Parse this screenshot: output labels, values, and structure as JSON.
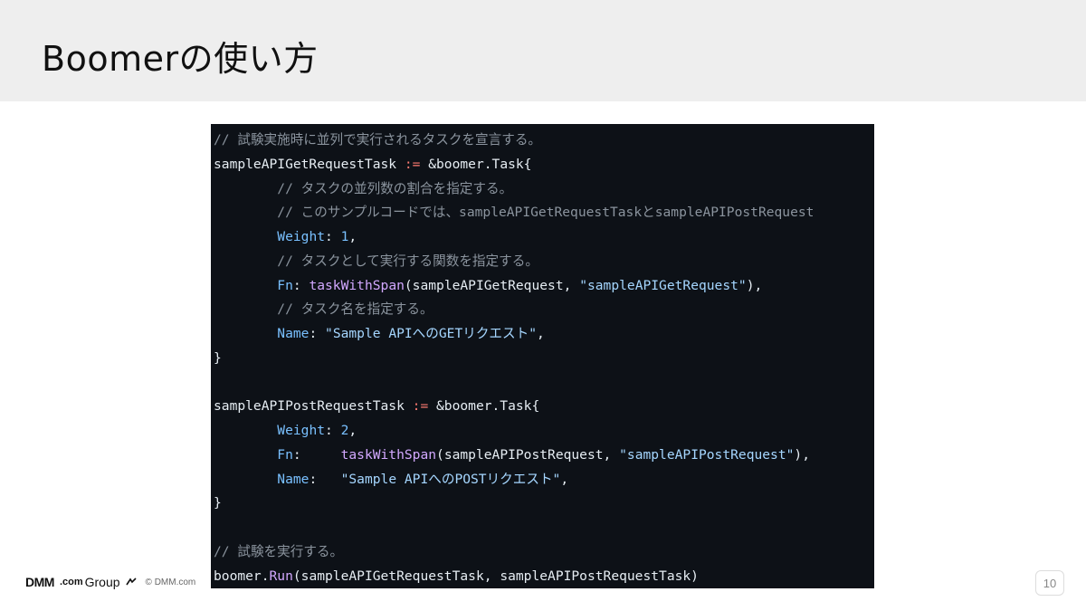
{
  "slide": {
    "title": "Boomerの使い方",
    "page_number": "10"
  },
  "footer": {
    "brand_main": "DMM",
    "brand_dotcom": ".com",
    "brand_group": "Group",
    "copyright": "© DMM.com"
  },
  "code": {
    "lines": [
      [
        [
          "comment",
          "// 試験実施時に並列で実行されるタスクを宣言する。"
        ]
      ],
      [
        [
          "plain",
          "sampleAPIGetRequestTask "
        ],
        [
          "op",
          ":="
        ],
        [
          "plain",
          " &boomer.Task{"
        ]
      ],
      [
        [
          "plain",
          "        "
        ],
        [
          "comment",
          "// タスクの並列数の割合を指定する。"
        ]
      ],
      [
        [
          "plain",
          "        "
        ],
        [
          "comment",
          "// このサンプルコードでは、sampleAPIGetRequestTaskとsampleAPIPostRequest"
        ]
      ],
      [
        [
          "plain",
          "        "
        ],
        [
          "field",
          "Weight"
        ],
        [
          "plain",
          ": "
        ],
        [
          "num",
          "1"
        ],
        [
          "plain",
          ","
        ]
      ],
      [
        [
          "plain",
          "        "
        ],
        [
          "comment",
          "// タスクとして実行する関数を指定する。"
        ]
      ],
      [
        [
          "plain",
          "        "
        ],
        [
          "field",
          "Fn"
        ],
        [
          "plain",
          ": "
        ],
        [
          "func",
          "taskWithSpan"
        ],
        [
          "plain",
          "(sampleAPIGetRequest, "
        ],
        [
          "str",
          "\"sampleAPIGetRequest\""
        ],
        [
          "plain",
          "),"
        ]
      ],
      [
        [
          "plain",
          "        "
        ],
        [
          "comment",
          "// タスク名を指定する。"
        ]
      ],
      [
        [
          "plain",
          "        "
        ],
        [
          "field",
          "Name"
        ],
        [
          "plain",
          ": "
        ],
        [
          "str",
          "\"Sample APIへのGETリクエスト\""
        ],
        [
          "plain",
          ","
        ]
      ],
      [
        [
          "plain",
          "}"
        ]
      ],
      [],
      [
        [
          "plain",
          "sampleAPIPostRequestTask "
        ],
        [
          "op",
          ":="
        ],
        [
          "plain",
          " &boomer.Task{"
        ]
      ],
      [
        [
          "plain",
          "        "
        ],
        [
          "field",
          "Weight"
        ],
        [
          "plain",
          ": "
        ],
        [
          "num",
          "2"
        ],
        [
          "plain",
          ","
        ]
      ],
      [
        [
          "plain",
          "        "
        ],
        [
          "field",
          "Fn"
        ],
        [
          "plain",
          ":     "
        ],
        [
          "func",
          "taskWithSpan"
        ],
        [
          "plain",
          "(sampleAPIPostRequest, "
        ],
        [
          "str",
          "\"sampleAPIPostRequest\""
        ],
        [
          "plain",
          "),"
        ]
      ],
      [
        [
          "plain",
          "        "
        ],
        [
          "field",
          "Name"
        ],
        [
          "plain",
          ":   "
        ],
        [
          "str",
          "\"Sample APIへのPOSTリクエスト\""
        ],
        [
          "plain",
          ","
        ]
      ],
      [
        [
          "plain",
          "}"
        ]
      ],
      [],
      [
        [
          "comment",
          "// 試験を実行する。"
        ]
      ],
      [
        [
          "plain",
          "boomer."
        ],
        [
          "func",
          "Run"
        ],
        [
          "plain",
          "(sampleAPIGetRequestTask, sampleAPIPostRequestTask)"
        ]
      ]
    ]
  },
  "colors": {
    "code_background": "#0d1117",
    "comment": "#8b949e",
    "field": "#79c0ff",
    "string": "#a5d6ff",
    "function": "#d2a8ff",
    "operator": "#ff7b72",
    "header_background": "#eeeeee"
  }
}
